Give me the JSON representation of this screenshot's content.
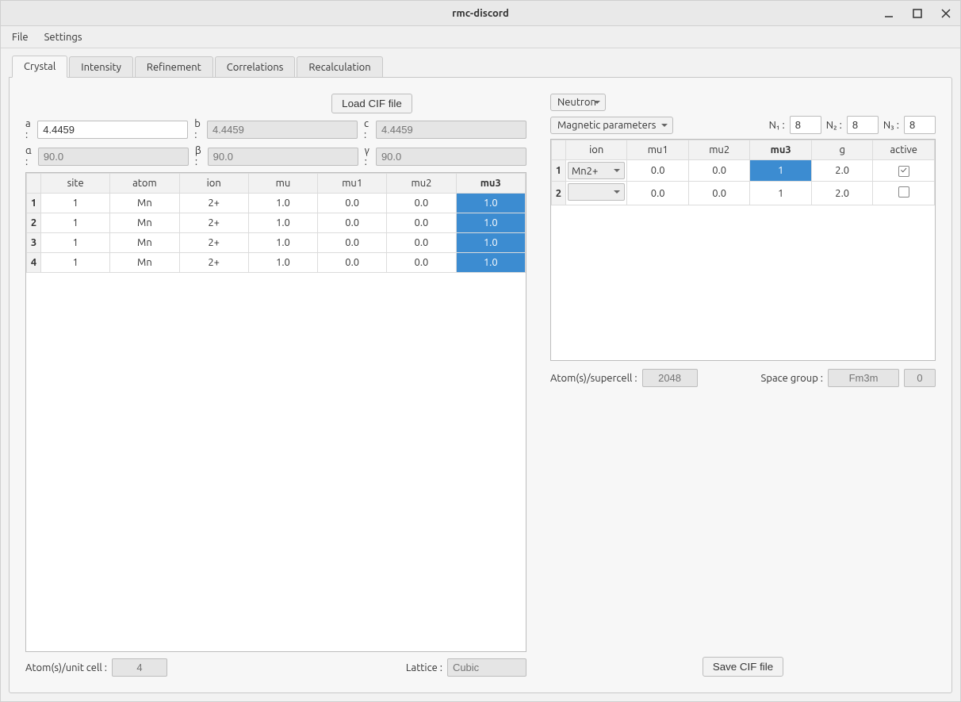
{
  "window": {
    "title": "rmc-discord"
  },
  "menubar": {
    "file": "File",
    "settings": "Settings"
  },
  "tabs": [
    "Crystal",
    "Intensity",
    "Refinement",
    "Correlations",
    "Recalculation"
  ],
  "load_cif": "Load CIF file",
  "lattice_labels": {
    "a": "a :",
    "b": "b :",
    "c": "c :",
    "alpha": "α :",
    "beta": "β :",
    "gamma": "γ :"
  },
  "lattice_values": {
    "a": "4.4459",
    "b": "4.4459",
    "c": "4.4459",
    "alpha": "90.0",
    "beta": "90.0",
    "gamma": "90.0"
  },
  "left_table": {
    "headers": [
      "site",
      "atom",
      "ion",
      "mu",
      "mu1",
      "mu2",
      "mu3"
    ],
    "rows": [
      {
        "n": "1",
        "site": "1",
        "atom": "Mn",
        "ion": "2+",
        "mu": "1.0",
        "mu1": "0.0",
        "mu2": "0.0",
        "mu3": "1.0"
      },
      {
        "n": "2",
        "site": "1",
        "atom": "Mn",
        "ion": "2+",
        "mu": "1.0",
        "mu1": "0.0",
        "mu2": "0.0",
        "mu3": "1.0"
      },
      {
        "n": "3",
        "site": "1",
        "atom": "Mn",
        "ion": "2+",
        "mu": "1.0",
        "mu1": "0.0",
        "mu2": "0.0",
        "mu3": "1.0"
      },
      {
        "n": "4",
        "site": "1",
        "atom": "Mn",
        "ion": "2+",
        "mu": "1.0",
        "mu1": "0.0",
        "mu2": "0.0",
        "mu3": "1.0"
      }
    ]
  },
  "atoms_unit_cell_label": "Atom(s)/unit cell :",
  "atoms_unit_cell": "4",
  "lattice_label": "Lattice :",
  "lattice_type": "Cubic",
  "scattering_select": "Neutron",
  "param_select": "Magnetic parameters",
  "n_labels": {
    "n1": "N₁ :",
    "n2": "N₂ :",
    "n3": "N₃ :"
  },
  "n_values": {
    "n1": "8",
    "n2": "8",
    "n3": "8"
  },
  "right_table": {
    "headers": [
      "ion",
      "mu1",
      "mu2",
      "mu3",
      "g",
      "active"
    ],
    "rows": [
      {
        "n": "1",
        "ion": "Mn2+",
        "mu1": "0.0",
        "mu2": "0.0",
        "mu3": "1",
        "g": "2.0",
        "active": true
      },
      {
        "n": "2",
        "ion": "",
        "mu1": "0.0",
        "mu2": "0.0",
        "mu3": "1",
        "g": "2.0",
        "active": false
      }
    ]
  },
  "atoms_supercell_label": "Atom(s)/supercell :",
  "atoms_supercell": "2048",
  "space_group_label": "Space group :",
  "space_group": "Fm3m",
  "space_group_num": "0",
  "save_cif": "Save CIF file"
}
